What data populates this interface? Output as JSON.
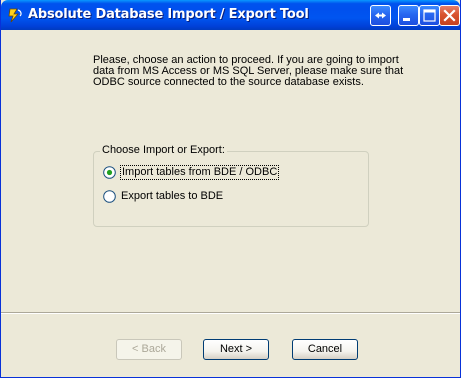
{
  "window": {
    "title": "Absolute Database Import / Export Tool"
  },
  "intro_text": "Please, choose an action to proceed. If you are going to import data from MS Access or MS SQL Server, please make sure that ODBC source connected to the source database exists.",
  "group": {
    "legend": "Choose Import or Export:",
    "options": [
      {
        "label": "Import tables from BDE / ODBC",
        "selected": true
      },
      {
        "label": "Export tables to BDE",
        "selected": false
      }
    ]
  },
  "buttons": {
    "back": "< Back",
    "next": "Next >",
    "cancel": "Cancel"
  },
  "colors": {
    "titlebar": "#0054e3",
    "dialog": "#ece9d8",
    "close_button": "#d9542f"
  },
  "icons": {
    "app": "lightning-feather-icon",
    "restore": "double-arrow-icon",
    "minimize": "minimize-icon",
    "maximize": "maximize-icon",
    "close": "close-icon"
  }
}
